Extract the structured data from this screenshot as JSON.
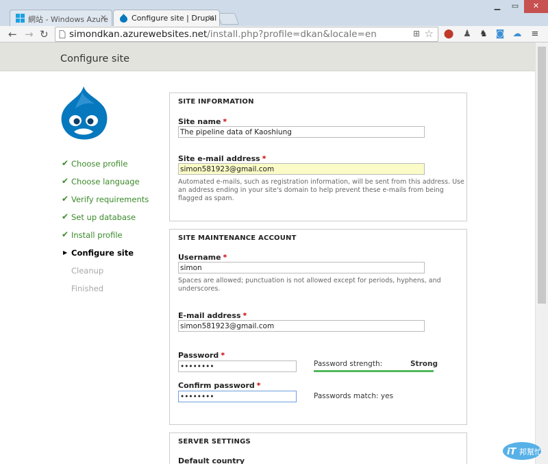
{
  "browser": {
    "tabs": [
      {
        "label": "網站 - Windows Azure"
      },
      {
        "label": "Configure site | Drupal"
      }
    ],
    "url_host": "simondkan.azurewebsites.net",
    "url_path": "/install.php?profile=dkan&locale=en"
  },
  "header": {
    "title": "Configure site"
  },
  "tasks": [
    {
      "label": "Choose profile",
      "state": "done"
    },
    {
      "label": "Choose language",
      "state": "done"
    },
    {
      "label": "Verify requirements",
      "state": "done"
    },
    {
      "label": "Set up database",
      "state": "done"
    },
    {
      "label": "Install profile",
      "state": "done"
    },
    {
      "label": "Configure site",
      "state": "active"
    },
    {
      "label": "Cleanup",
      "state": "pending"
    },
    {
      "label": "Finished",
      "state": "pending"
    }
  ],
  "site_information": {
    "legend": "SITE INFORMATION",
    "site_name_label": "Site name",
    "site_name_value": "The pipeline data of Kaoshiung",
    "site_email_label": "Site e-mail address",
    "site_email_value": "simon581923@gmail.com",
    "site_email_desc_1": "Automated e-mails, such as registration information, will be sent from this address. Use",
    "site_email_desc_2": "an address ending in your site's domain to help prevent these e-mails from being",
    "site_email_desc_3": "flagged as spam.",
    "required_mark": "*"
  },
  "maintenance": {
    "legend": "SITE MAINTENANCE ACCOUNT",
    "username_label": "Username",
    "username_value": "simon",
    "username_desc_1": "Spaces are allowed; punctuation is not allowed except for periods, hyphens, and",
    "username_desc_2": "underscores.",
    "email_label": "E-mail address",
    "email_value": "simon581923@gmail.com",
    "password_label": "Password",
    "password_value": "••••••••",
    "strength_label": "Password strength:",
    "strength_value": "Strong",
    "strength_level": 1.0,
    "confirm_label": "Confirm password",
    "confirm_value": "••••••••",
    "match_text": "Passwords match: yes"
  },
  "server": {
    "legend": "SERVER SETTINGS",
    "country_label": "Default country"
  },
  "colors": {
    "success": "#3a8a2a",
    "required": "#cc0000",
    "strength_bar": "#53b85a",
    "drupal_blue": "#0678be"
  }
}
